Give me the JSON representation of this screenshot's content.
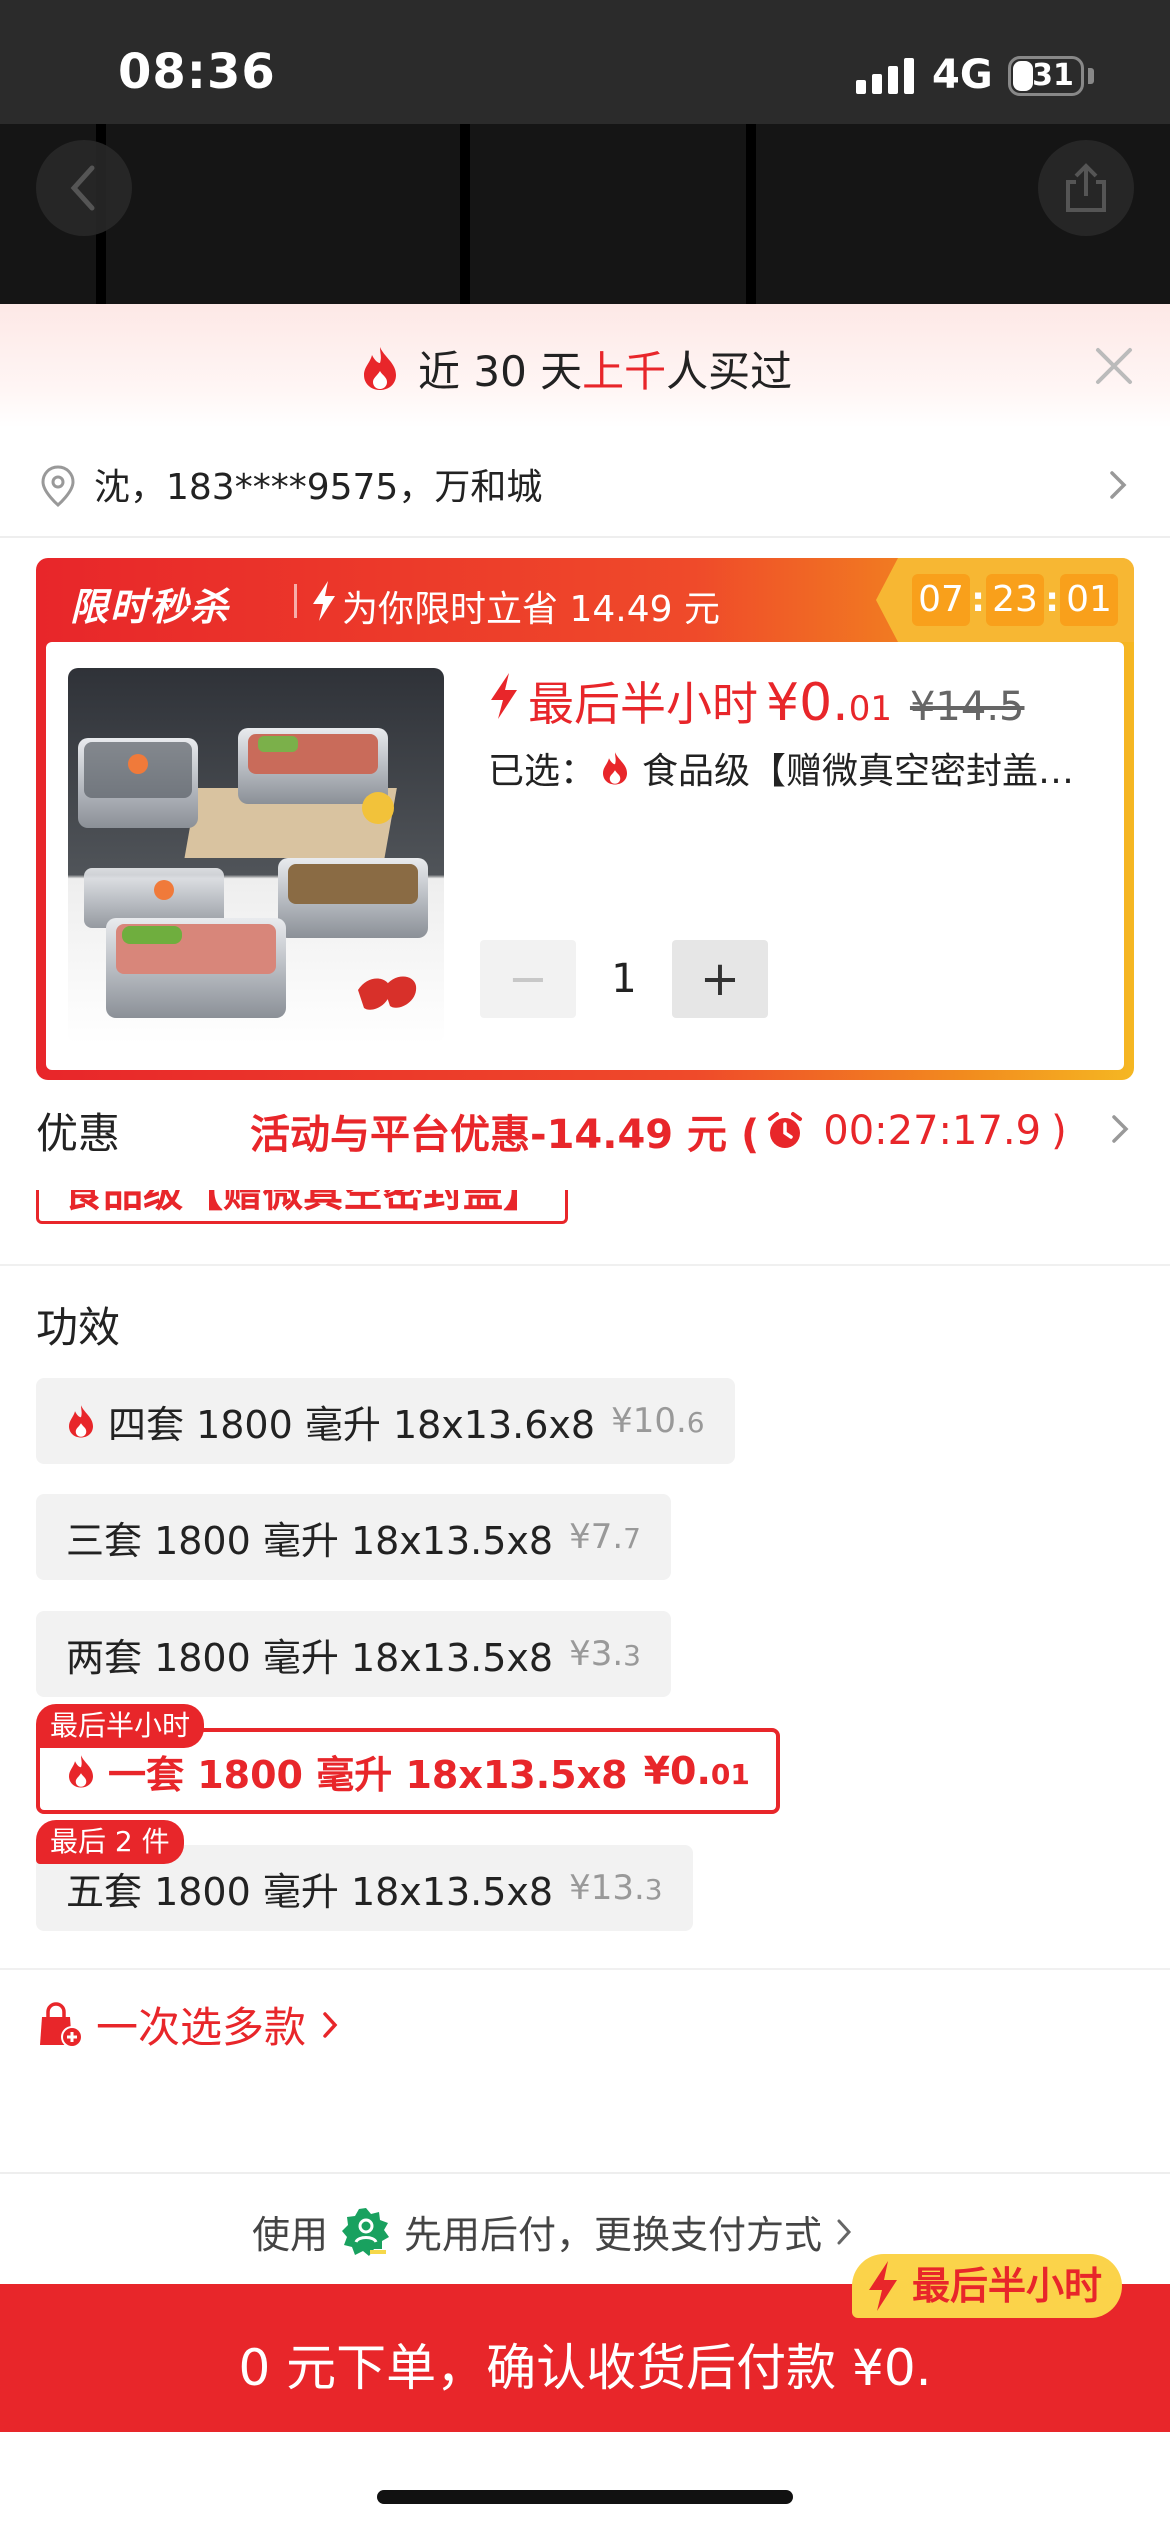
{
  "status_bar": {
    "time": "08:36",
    "network": "4G",
    "battery": "31"
  },
  "banner": {
    "prefix": "近 30 天",
    "highlight": "上千",
    "suffix": "人买过"
  },
  "address": {
    "text": "沈，183****9575，万和城"
  },
  "flash_sale": {
    "title": "限时秒杀",
    "subtitle": "为你限时立省 14.49 元",
    "timer": [
      "07",
      "23",
      "01"
    ]
  },
  "product": {
    "price_label": "最后半小时",
    "price_main": "¥0.",
    "price_cents": "01",
    "original_price": "¥14.5",
    "selected_prefix": "已选：",
    "selected_value": "食品级【赠微真空密封盖…",
    "quantity": "1",
    "minus": "−",
    "plus": "+"
  },
  "discount": {
    "label": "优惠",
    "text": "活动与平台优惠-14.49 元 (",
    "countdown": "00:27:17.9",
    "close_paren": ")"
  },
  "peek_chip": {
    "label": "食品级【赠微真空密封盖】"
  },
  "options_section": {
    "title": "功效",
    "options": [
      {
        "label": "四套 1800 毫升 18x13.6x8",
        "price": "¥10.",
        "cents": "6",
        "hot": true,
        "active": false,
        "tag": ""
      },
      {
        "label": "三套 1800 毫升 18x13.5x8",
        "price": "¥7.",
        "cents": "7",
        "hot": false,
        "active": false,
        "tag": ""
      },
      {
        "label": "两套 1800 毫升 18x13.5x8",
        "price": "¥3.",
        "cents": "3",
        "hot": false,
        "active": false,
        "tag": ""
      },
      {
        "label": "一套 1800 毫升 18x13.5x8",
        "price": "¥0.",
        "cents": "01",
        "hot": true,
        "active": true,
        "tag": "最后半小时"
      },
      {
        "label": "五套 1800 毫升 18x13.5x8",
        "price": "¥13.",
        "cents": "3",
        "hot": false,
        "active": false,
        "tag": "最后 2 件"
      }
    ]
  },
  "multi_select": {
    "label": "一次选多款"
  },
  "payment": {
    "prefix": "使用",
    "text": "先用后付，更换支付方式"
  },
  "cta": {
    "text": "0 元下单，确认收货后付款 ¥0.",
    "badge": "最后半小时"
  },
  "colors": {
    "brand_red": "#e8262a",
    "timer_yellow": "#f7b733",
    "badge_yellow": "#fbd34a",
    "pay_green": "#19a15f"
  }
}
